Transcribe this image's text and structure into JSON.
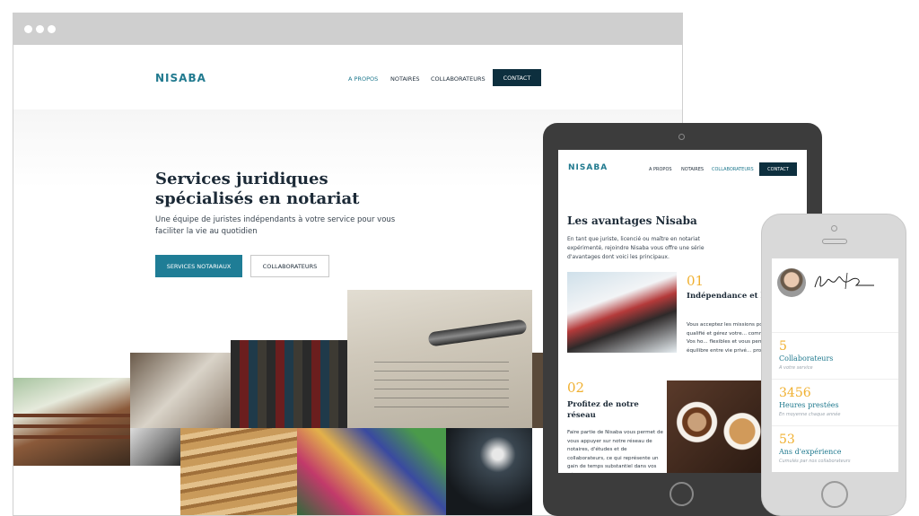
{
  "desktop": {
    "logo": "NISABA",
    "nav": [
      "A PROPOS",
      "NOTAIRES",
      "COLLABORATEURS"
    ],
    "contact": "CONTACT",
    "hero_title": "Services juridiques spécialisés en notariat",
    "hero_subtitle": "Une équipe de juristes indépendants à votre service pour vous faciliter la vie au quotidien",
    "btn_primary": "SERVICES NOTARIAUX",
    "btn_secondary": "COLLABORATEURS",
    "collage_images": [
      "bridge-photo",
      "desk-photo",
      "books-photo",
      "fountain-pen-photo",
      "pen-nib-photo",
      "folders-photo",
      "mural-photo",
      "lamp-photo"
    ]
  },
  "tablet": {
    "logo": "NISABA",
    "nav": [
      "A PROPOS",
      "NOTAIRES",
      "COLLABORATEURS"
    ],
    "contact": "CONTACT",
    "title": "Les avantages Nisaba",
    "intro": "En tant que juriste, licencié ou maître en notariat expérimenté, rejoindre Nisaba vous offre une série d'avantages dont voici les principaux.",
    "features": [
      {
        "number": "01",
        "heading": "Indépendance et h... flexibles",
        "text": "Vous acceptez les missions pou... vous êtes qualifié et gérez votre... comme vous l'entendez. Vos ho... flexibles et vous permettent de... propre équilibre entre vie privé... professionnelle."
      },
      {
        "number": "02",
        "heading": "Profitez de notre réseau",
        "text": "Faire partie de Nisaba vous permet de vous appuyer sur notre réseau de notaires, d'études et de collaborateurs, ce qui représente un gain de temps substantiel dans vos démarches commerciales."
      }
    ]
  },
  "phone": {
    "stats": [
      {
        "value": "5",
        "label": "Collaborateurs",
        "sub": "A votre service"
      },
      {
        "value": "3456",
        "label": "Heures prestées",
        "sub": "En moyenne chaque année"
      },
      {
        "value": "53",
        "label": "Ans d'expérience",
        "sub": "Cumulés par nos collaborateurs"
      }
    ]
  },
  "colors": {
    "brand_teal": "#217a8f",
    "navy": "#0d2f3e",
    "accent_gold": "#f0b030",
    "device_dark": "#3c3c3c",
    "device_light": "#d9d9d9"
  }
}
